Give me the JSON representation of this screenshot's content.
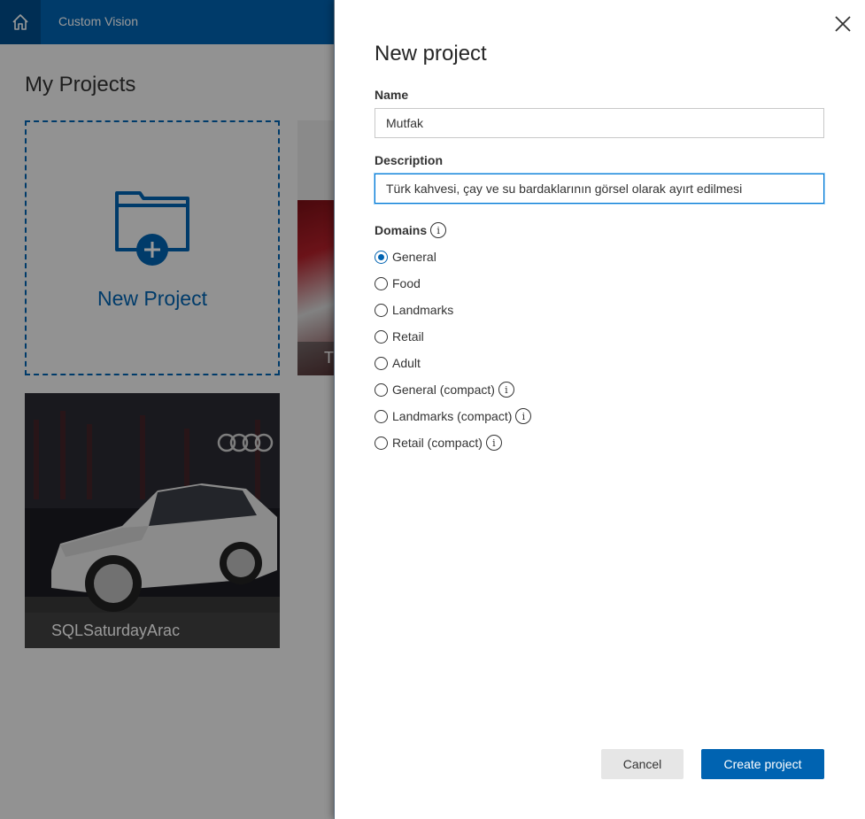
{
  "header": {
    "app_title": "Custom Vision",
    "home_icon": "home-icon"
  },
  "projects_page": {
    "heading": "My Projects",
    "new_project_tile_label": "New Project",
    "tiles": [
      {
        "caption": "T"
      },
      {
        "caption": "SQLSaturdayArac"
      }
    ]
  },
  "dialog": {
    "title": "New project",
    "close_icon": "close-icon",
    "name_label": "Name",
    "name_value": "Mutfak",
    "description_label": "Description",
    "description_value": "Türk kahvesi, çay ve su bardaklarının görsel olarak ayırt edilmesi",
    "domains_label": "Domains",
    "domains": [
      {
        "label": "General",
        "selected": true,
        "info": false
      },
      {
        "label": "Food",
        "selected": false,
        "info": false
      },
      {
        "label": "Landmarks",
        "selected": false,
        "info": false
      },
      {
        "label": "Retail",
        "selected": false,
        "info": false
      },
      {
        "label": "Adult",
        "selected": false,
        "info": false
      },
      {
        "label": "General (compact)",
        "selected": false,
        "info": true
      },
      {
        "label": "Landmarks (compact)",
        "selected": false,
        "info": true
      },
      {
        "label": "Retail (compact)",
        "selected": false,
        "info": true
      }
    ],
    "info_glyph": "i",
    "cancel_label": "Cancel",
    "create_label": "Create project"
  },
  "colors": {
    "accent": "#0063b1",
    "topbar": "#0063b1",
    "home_button": "#004e8c"
  }
}
